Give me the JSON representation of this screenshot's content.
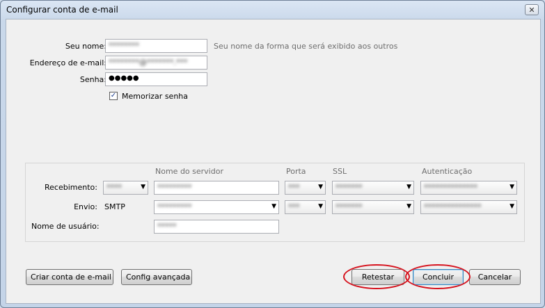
{
  "window": {
    "title": "Configurar conta de e-mail",
    "close_glyph": "✕"
  },
  "account": {
    "name_label": "Seu nome:",
    "name_value": "********",
    "name_hint": "Seu nome da forma que será exibido aos outros",
    "email_label": "Endereço de e-mail:",
    "email_value": "********@*******.***",
    "password_label": "Senha:",
    "password_value": "●●●●●",
    "remember_checked": true,
    "remember_label": "Memorizar senha"
  },
  "server": {
    "headers": {
      "server_name": "Nome do servidor",
      "port": "Porta",
      "ssl": "SSL",
      "auth": "Autenticação"
    },
    "incoming": {
      "label": "Recebimento:",
      "protocol": "****",
      "server": "*********",
      "port": "***",
      "ssl": "*******",
      "auth": "**************"
    },
    "outgoing": {
      "label": "Envio:",
      "protocol": "SMTP",
      "server": "*********",
      "port": "***",
      "ssl": "*******",
      "auth": "***************"
    },
    "username_label": "Nome de usuário:",
    "username_value": "*****"
  },
  "buttons": {
    "create_account": "Criar conta de e-mail",
    "advanced": "Config avançada",
    "retest": "Retestar",
    "finish": "Concluir",
    "cancel": "Cancelar"
  },
  "colors": {
    "annotation_ring": "#d6121d",
    "hint_text": "#6d6d6d"
  }
}
